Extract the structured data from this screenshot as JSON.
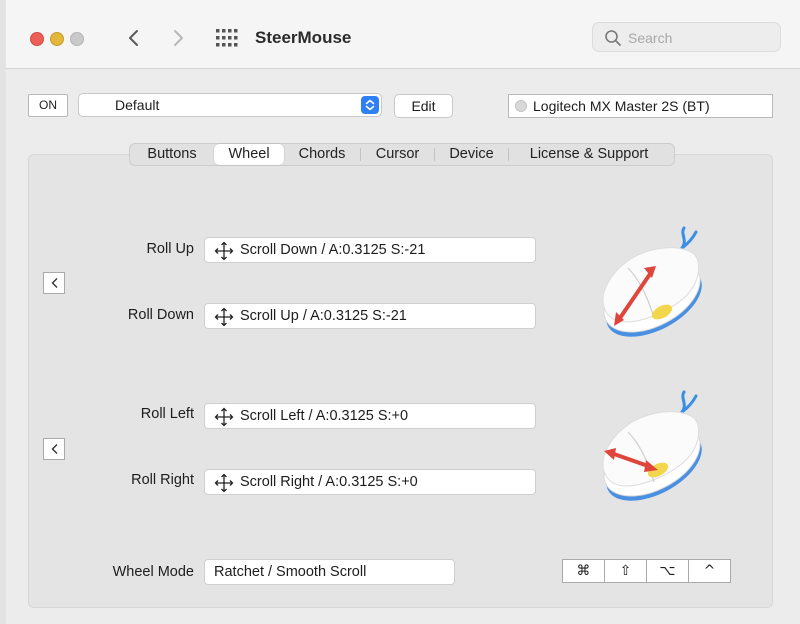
{
  "window": {
    "title": "SteerMouse",
    "search_placeholder": "Search"
  },
  "toolbar": {
    "on_label": "ON",
    "profile": "Default",
    "edit_label": "Edit",
    "device": "Logitech MX Master 2S (BT)"
  },
  "tabs": [
    {
      "label": "Buttons",
      "selected": false
    },
    {
      "label": "Wheel",
      "selected": true
    },
    {
      "label": "Chords",
      "selected": false
    },
    {
      "label": "Cursor",
      "selected": false
    },
    {
      "label": "Device",
      "selected": false
    },
    {
      "label": "License & Support",
      "selected": false
    }
  ],
  "vertical": {
    "roll_up_label": "Roll Up",
    "roll_up_value": "Scroll Down / A:0.3125 S:-21",
    "roll_down_label": "Roll Down",
    "roll_down_value": "Scroll Up / A:0.3125 S:-21"
  },
  "horizontal": {
    "roll_left_label": "Roll Left",
    "roll_left_value": "Scroll Left / A:0.3125 S:+0",
    "roll_right_label": "Roll Right",
    "roll_right_value": "Scroll Right / A:0.3125 S:+0"
  },
  "wheel_mode": {
    "label": "Wheel Mode",
    "value": "Ratchet / Smooth Scroll"
  },
  "modifiers": [
    "⌘",
    "⇧",
    "⌥",
    "^"
  ],
  "colors": {
    "accent": "#2f7ff5",
    "arrow": "#e0453c",
    "wheel": "#f2d64b",
    "mouse_base": "#4a90e2"
  },
  "icons": {
    "back": "chevron-left-icon",
    "forward": "chevron-right-icon",
    "grid": "app-grid-icon",
    "search": "magnifier-icon",
    "move": "four-way-arrow-icon"
  }
}
